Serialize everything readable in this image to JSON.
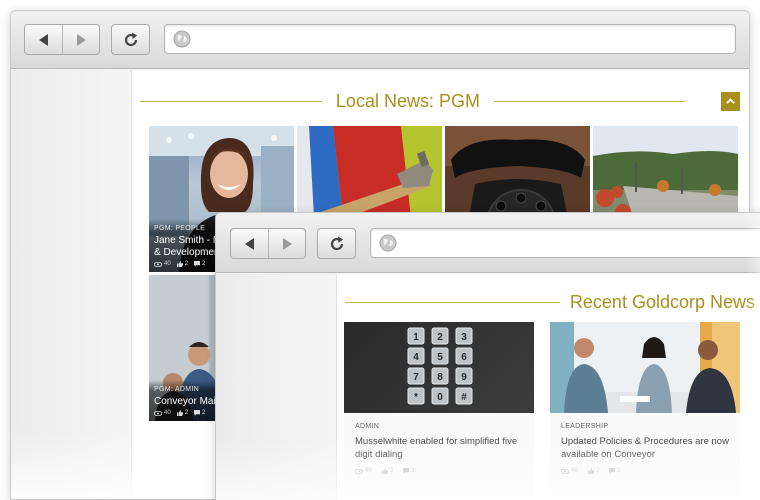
{
  "window_back": {
    "address": {
      "value": "",
      "placeholder": ""
    },
    "section_title": "Local News: PGM",
    "tiles": [
      {
        "category": "PGM: PEOPLE",
        "title": "Jane Smith - M",
        "title2": "& Development",
        "views": "40",
        "likes": "2",
        "comments": "2"
      },
      {
        "category": "",
        "title": "",
        "title2": "",
        "views": "",
        "likes": "",
        "comments": ""
      },
      {
        "category": "",
        "title": "",
        "title2": "",
        "views": "",
        "likes": "",
        "comments": ""
      },
      {
        "category": "",
        "title": "",
        "title2": "",
        "views": "",
        "likes": "",
        "comments": ""
      },
      {
        "category": "PGM: ADMIN",
        "title": "Conveyor Main",
        "title2": "",
        "views": "40",
        "likes": "2",
        "comments": "2"
      }
    ]
  },
  "window_front": {
    "address": {
      "value": "",
      "placeholder": ""
    },
    "section_title": "Recent Goldcorp News",
    "cards": [
      {
        "category": "ADMIN",
        "title": "Musselwhite enabled for simplified five digit dialing",
        "views": "40",
        "likes": "2",
        "comments": "3"
      },
      {
        "category": "LEADERSHIP",
        "title": "Updated Policies & Procedures are now available on Conveyor",
        "views": "40",
        "likes": "2",
        "comments": "3"
      }
    ]
  },
  "keypad_keys": [
    "1",
    "2",
    "3",
    "4",
    "5",
    "6",
    "7",
    "8",
    "9",
    "*",
    "0",
    "#"
  ],
  "icons": {
    "back": "back-arrow-icon",
    "forward": "forward-arrow-icon",
    "reload": "reload-icon",
    "site": "globe-icon",
    "collapse": "chevron-up-icon",
    "views": "eye-icon",
    "likes": "thumbs-up-icon",
    "comments": "comment-icon"
  },
  "colors": {
    "accent": "#a8901c",
    "rule": "#c6b24a",
    "chrome": "#e4e4e4"
  }
}
